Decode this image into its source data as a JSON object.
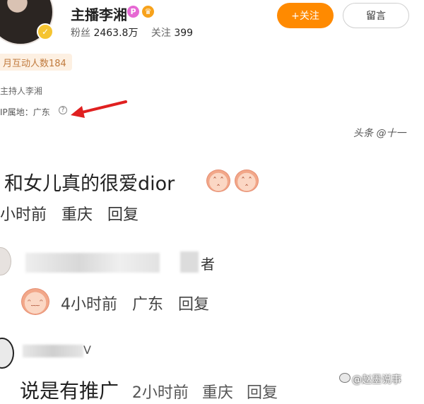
{
  "profile": {
    "name": "主播李湘",
    "badge_p": "P",
    "badge_crown": "♛",
    "fans_label": "粉丝",
    "fans_value": "2463.8万",
    "following_label": "关注",
    "following_value": "399",
    "verify_mark": "✓",
    "follow_button": "+关注",
    "message_button": "留言",
    "monthly_interactions": "月互动人数184",
    "host_label": "主持人李湘",
    "ip_label": "IP属地：广东",
    "help_mark": "?"
  },
  "watermarks": {
    "top": "头条 @十一",
    "bottom": "@赵墨说事"
  },
  "comments": [
    {
      "text": "和女儿真的很爱dior",
      "time": "小时前",
      "location": "重庆",
      "reply": "回复"
    },
    {
      "author_tail": "者",
      "time": "4小时前",
      "location": "广东",
      "reply": "回复"
    },
    {
      "author_tail": "V",
      "text": "说是有推广",
      "time": "2小时前",
      "location": "重庆",
      "reply": "回复"
    }
  ],
  "colors": {
    "accent": "#ff8a00",
    "badge_bg": "#fdf0e2",
    "arrow": "#e02020"
  }
}
